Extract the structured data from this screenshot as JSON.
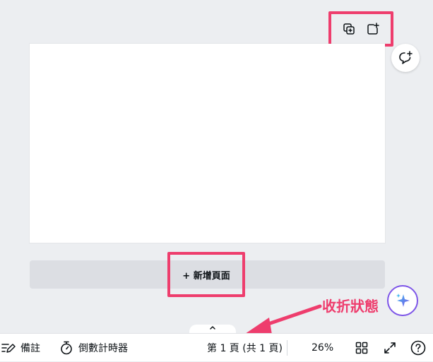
{
  "page": {
    "add_page_label": "+ 新增頁面",
    "annotation_text": "收折狀態"
  },
  "toolbar": {
    "icons": [
      "duplicate-page-icon",
      "add-page-icon"
    ]
  },
  "footer": {
    "notes_label": "備註",
    "timer_label": "倒數計時器",
    "page_indicator": "第 1 頁 (共 1 頁)",
    "zoom_level": "26%",
    "icons": [
      "notes-icon",
      "timer-icon",
      "grid-view-icon",
      "fullscreen-icon",
      "help-icon",
      "collapse-chevron-icon"
    ]
  },
  "colors": {
    "highlight": "#ee3d6d",
    "canvas_bg": "#eceef1",
    "magic_accent": "#7d55e8"
  }
}
